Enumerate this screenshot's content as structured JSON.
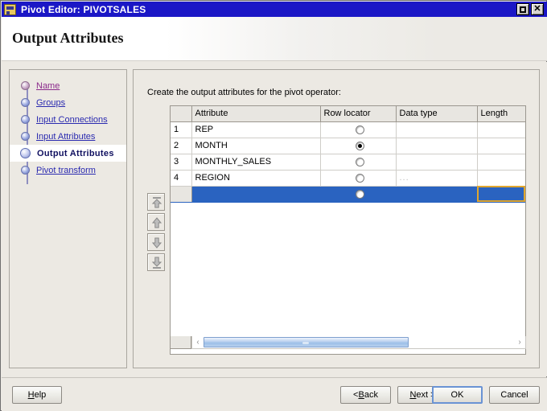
{
  "window": {
    "title": "Pivot Editor: PIVOTSALES",
    "icon": "app-icon",
    "maximize_label": "Maximize",
    "close_label": "Close",
    "close_glyph": "✕"
  },
  "header": {
    "title": "Output Attributes"
  },
  "sidebar": {
    "items": [
      {
        "label": "Name",
        "state": "visited"
      },
      {
        "label": "Groups",
        "state": "link"
      },
      {
        "label": "Input Connections",
        "state": "link"
      },
      {
        "label": "Input Attributes",
        "state": "link"
      },
      {
        "label": "Output Attributes",
        "state": "current"
      },
      {
        "label": "Pivot transform",
        "state": "link"
      }
    ]
  },
  "content": {
    "instruction": "Create the output attributes for the pivot operator:",
    "move_buttons": [
      {
        "name": "move-to-top-button",
        "direction": "up-bar"
      },
      {
        "name": "move-up-button",
        "direction": "up"
      },
      {
        "name": "move-down-button",
        "direction": "down"
      },
      {
        "name": "move-to-bottom-button",
        "direction": "down-bar"
      }
    ],
    "table": {
      "columns": [
        "",
        "Attribute",
        "Row locator",
        "Data type",
        "Length"
      ],
      "rows": [
        {
          "num": "1",
          "attribute": "REP",
          "row_locator": false,
          "data_type": "",
          "length": "",
          "selected": false
        },
        {
          "num": "2",
          "attribute": "MONTH",
          "row_locator": true,
          "data_type": "",
          "length": "",
          "selected": false
        },
        {
          "num": "3",
          "attribute": "MONTHLY_SALES",
          "row_locator": false,
          "data_type": "",
          "length": "",
          "selected": false
        },
        {
          "num": "4",
          "attribute": "REGION",
          "row_locator": false,
          "data_type": "...",
          "length": "",
          "selected": false
        },
        {
          "num": "",
          "attribute": "",
          "row_locator": false,
          "data_type": "",
          "length": "",
          "selected": true
        }
      ]
    },
    "scrollbar": {
      "left_arrow": "‹",
      "right_arrow": "›",
      "thumb_percent": 66
    }
  },
  "footer": {
    "help": {
      "prefix": "",
      "accel": "H",
      "suffix": "elp"
    },
    "back": {
      "prefix": "< ",
      "accel": "B",
      "suffix": "ack"
    },
    "next": {
      "prefix": "",
      "accel": "N",
      "suffix": "ext >"
    },
    "ok": {
      "prefix": "OK",
      "accel": "",
      "suffix": ""
    },
    "cancel": {
      "prefix": "Cancel",
      "accel": "",
      "suffix": ""
    }
  },
  "colors": {
    "titlebar": "#1b17c6",
    "selection": "#2a63c0",
    "focus_cell_border": "#e0a62e",
    "link": "#2a2ab0",
    "visited_link": "#8b2a8b",
    "locator_column": "#c3c2bf",
    "panel": "#ece9e3"
  }
}
